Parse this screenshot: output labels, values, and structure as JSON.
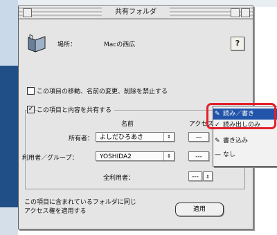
{
  "window": {
    "title": "共有フォルダ"
  },
  "info": {
    "where_label": "場所：",
    "where_value": "Macの西広"
  },
  "help_button": "?",
  "options": {
    "lock_checkbox_label": "この項目の移動、名前の変更、削除を禁止する",
    "share_checkbox_label": "この項目と内容を共有する"
  },
  "table": {
    "name_header": "名前",
    "access_header": "アクセス"
  },
  "owner": {
    "label": "所有者：",
    "value": "よしだひろあき",
    "arrow": "⇕",
    "access_value": "—"
  },
  "group": {
    "label": "利用者／グループ：",
    "value": "YOSHIDA2",
    "access_value": "---"
  },
  "everyone": {
    "label": "全利用者：",
    "access_value": "---"
  },
  "footer": {
    "text_line1": "この項目に含まれているフォルダに同じ",
    "text_line2": "アクセス権を適用する",
    "apply_button": "適用"
  },
  "access_menu": {
    "items": [
      {
        "icon": "✎",
        "label": "読み／書き",
        "selected": true
      },
      {
        "icon": "✓",
        "label": "読み出しのみ",
        "selected": false
      },
      {
        "icon": "✎",
        "label": "書き込み",
        "selected": false
      },
      {
        "icon": "—",
        "label": "なし",
        "selected": false
      }
    ]
  }
}
